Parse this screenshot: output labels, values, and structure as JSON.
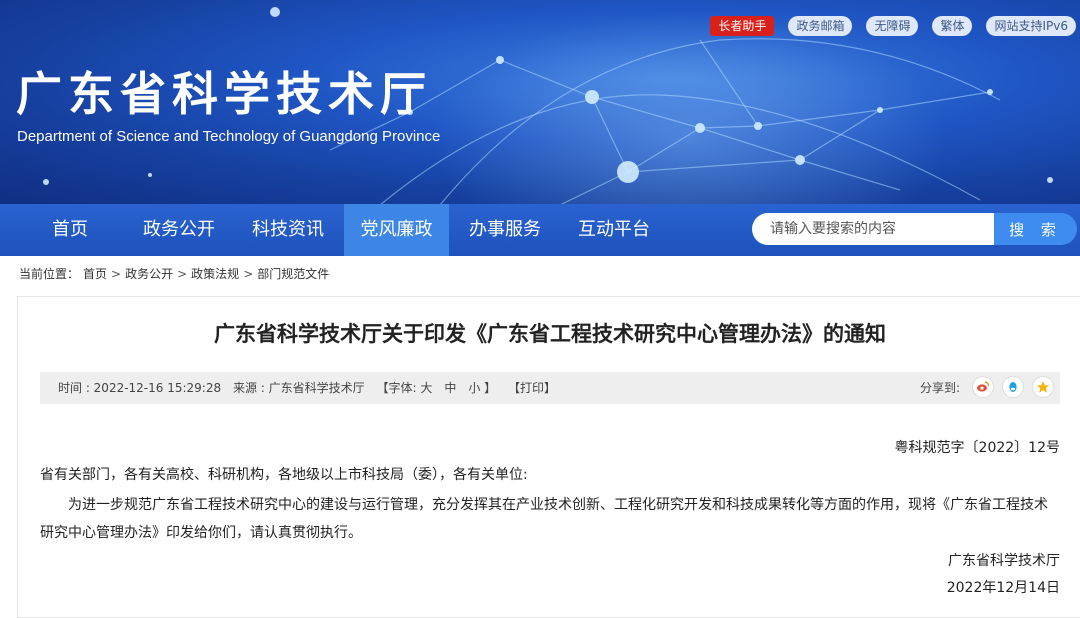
{
  "header": {
    "title_cn": "广东省科学技术厅",
    "title_en": "Department of Science and Technology of Guangdong Province",
    "toplinks": [
      "长者助手",
      "政务邮箱",
      "无障碍",
      "繁体",
      "网站支持IPv6"
    ]
  },
  "nav": {
    "items": [
      "首页",
      "政务公开",
      "科技资讯",
      "党风廉政",
      "办事服务",
      "互动平台"
    ],
    "active": "党风廉政"
  },
  "search": {
    "placeholder": "请输入要搜索的内容",
    "button": "搜 索"
  },
  "breadcrumb": {
    "prefix": "当前位置：",
    "items": [
      "首页",
      "政务公开",
      "政策法规",
      "部门规范文件"
    ],
    "sep": ">"
  },
  "article": {
    "title": "广东省科学技术厅关于印发《广东省工程技术研究中心管理办法》的通知",
    "meta": {
      "time": "时间 : 2022-12-16 15:29:28",
      "source": "来源 : 广东省科学技术厅",
      "font_size": "【字体: 大　中　小 】",
      "print": "【打印】",
      "share_label": "分享到:"
    },
    "doc_no": "粤科规范字〔2022〕12号",
    "greeting": "省有关部门，各有关高校、科研机构，各地级以上市科技局（委），各有关单位:",
    "paragraph": "为进一步规范广东省工程技术研究中心的建设与运行管理，充分发挥其在产业技术创新、工程化研究开发和科技成果转化等方面的作用，现将《广东省工程技术研究中心管理办法》印发给你们，请认真贯彻执行。",
    "signature": "广东省科学技术厅",
    "date": "2022年12月14日"
  },
  "icons": {
    "share": [
      "weibo-icon",
      "qq-icon",
      "qzone-icon"
    ]
  },
  "colors": {
    "nav": "#1e52bc",
    "nav_active": "#3d86e6",
    "elder_badge": "#d9211c",
    "search_button": "#3f8cf0"
  }
}
